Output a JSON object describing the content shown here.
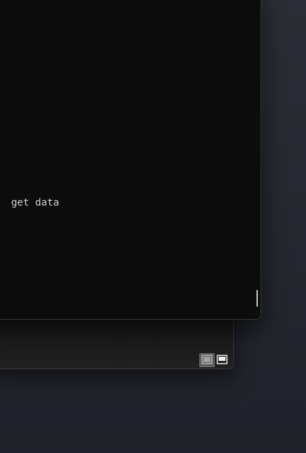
{
  "terminal": {
    "line_text": "   get data"
  },
  "back_window": {
    "view_toggle": {
      "list_view_icon": "list-view-icon",
      "single_view_icon": "single-pane-view-icon",
      "active": "list"
    }
  }
}
